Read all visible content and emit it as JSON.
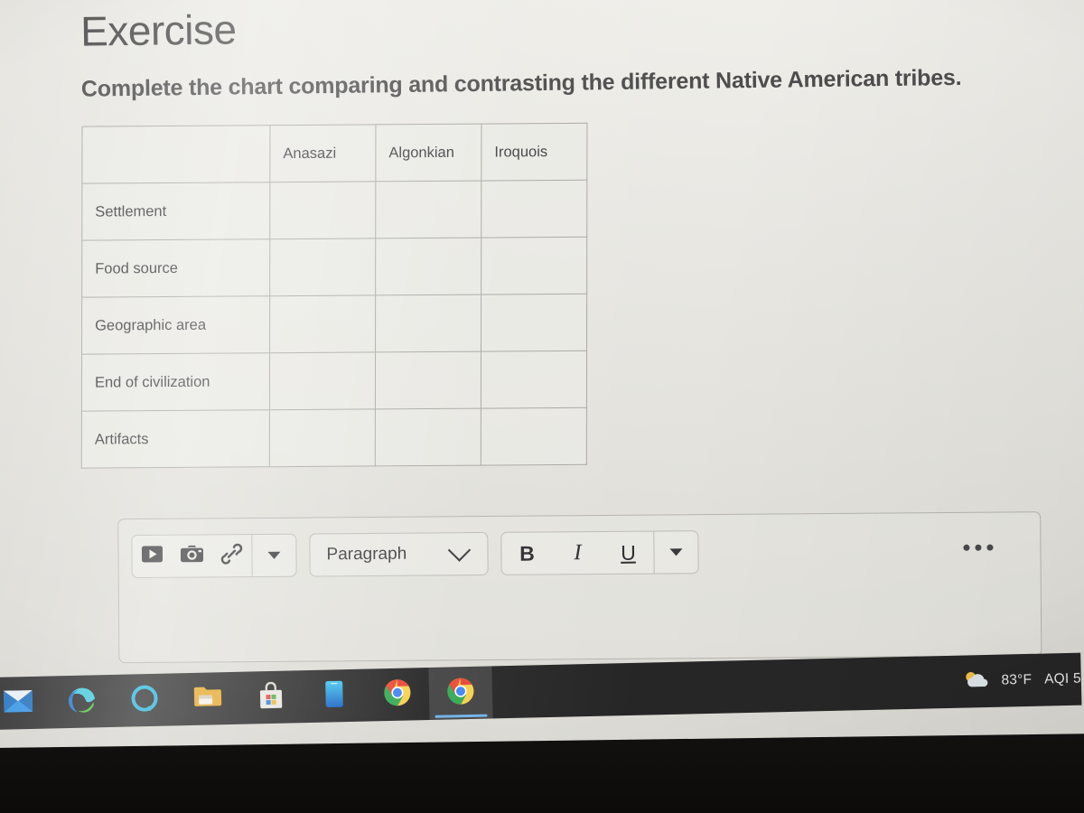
{
  "page": {
    "title": "Exercise",
    "instruction": "Complete the chart comparing and contrasting the different Native American tribes."
  },
  "table": {
    "corner_label": "",
    "columns": [
      "Anasazi",
      "Algonkian",
      "Iroquois"
    ],
    "rows": [
      {
        "label": "Settlement",
        "cells": [
          "",
          "",
          ""
        ]
      },
      {
        "label": "Food source",
        "cells": [
          "",
          "",
          ""
        ]
      },
      {
        "label": "Geographic area",
        "cells": [
          "",
          "",
          ""
        ]
      },
      {
        "label": "End of civilization",
        "cells": [
          "",
          "",
          ""
        ]
      },
      {
        "label": "Artifacts",
        "cells": [
          "",
          "",
          ""
        ]
      }
    ]
  },
  "editor": {
    "media_group": {
      "video_icon": "video-icon",
      "camera_icon": "camera-icon",
      "link_icon": "link-icon",
      "overflow_icon": "caret-down-icon"
    },
    "block_format": {
      "value": "Paragraph",
      "chevron_icon": "chevron-down-icon"
    },
    "text_format": {
      "bold_label": "B",
      "italic_label": "I",
      "underline_label": "U",
      "overflow_icon": "caret-down-icon"
    },
    "more_options_icon": "ellipsis-icon",
    "content": ""
  },
  "taskbar": {
    "items": [
      {
        "name": "mail-icon",
        "label": "Mail",
        "active": false
      },
      {
        "name": "edge-icon",
        "label": "Microsoft Edge",
        "active": false
      },
      {
        "name": "alexa-icon",
        "label": "Alexa",
        "active": false
      },
      {
        "name": "explorer-icon",
        "label": "File Explorer",
        "active": false
      },
      {
        "name": "store-icon",
        "label": "Microsoft Store",
        "active": false
      },
      {
        "name": "phone-icon",
        "label": "Your Phone",
        "active": false
      },
      {
        "name": "chrome-icon",
        "label": "Google Chrome",
        "active": false
      },
      {
        "name": "chrome-icon-2",
        "label": "Google Chrome",
        "active": true
      }
    ],
    "weather": {
      "icon": "partly-cloudy-icon",
      "temperature": "83°F",
      "air_quality": "AQI 5"
    }
  },
  "colors": {
    "page_background": "#e9e8e3",
    "text": "#4a4a4a",
    "table_border": "#a9a8a3",
    "taskbar": "#262626",
    "active_tab_underline": "#6fb2e8"
  }
}
